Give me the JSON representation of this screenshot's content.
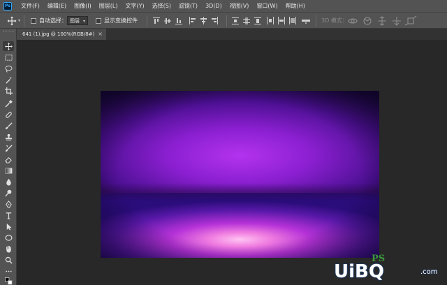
{
  "menu": {
    "logo": "Ps",
    "items": [
      "文件(F)",
      "编辑(E)",
      "图像(I)",
      "图层(L)",
      "文字(Y)",
      "选择(S)",
      "滤镜(T)",
      "3D(D)",
      "视图(V)",
      "窗口(W)",
      "帮助(H)"
    ]
  },
  "options": {
    "auto_select_label": "自动选择：",
    "auto_select_value": "图层",
    "show_transform_label": "显示变换控件",
    "mode_3d_label": "3D 模式："
  },
  "document": {
    "tab_title": "641 (1).jpg @ 100%(RGB/8#)",
    "close_glyph": "×"
  },
  "tools": [
    "move-tool",
    "marquee-tool",
    "lasso-tool",
    "magic-wand-tool",
    "crop-tool",
    "eyedropper-tool",
    "healing-brush-tool",
    "brush-tool",
    "clone-stamp-tool",
    "history-brush-tool",
    "eraser-tool",
    "gradient-tool",
    "blur-tool",
    "dodge-tool",
    "pen-tool",
    "type-tool",
    "path-selection-tool",
    "ellipse-tool",
    "hand-tool",
    "zoom-tool",
    "more-tools",
    "color-swatches"
  ],
  "colors": {
    "ui_panel": "#535353",
    "workspace": "#282828",
    "accent": "#31a8ff",
    "canvas_purple": "#8a1fd0",
    "canvas_glow": "#ffb8f0"
  },
  "watermark": {
    "brand": "UiBQ",
    "suffix": ".com",
    "ps_label": "PS"
  }
}
